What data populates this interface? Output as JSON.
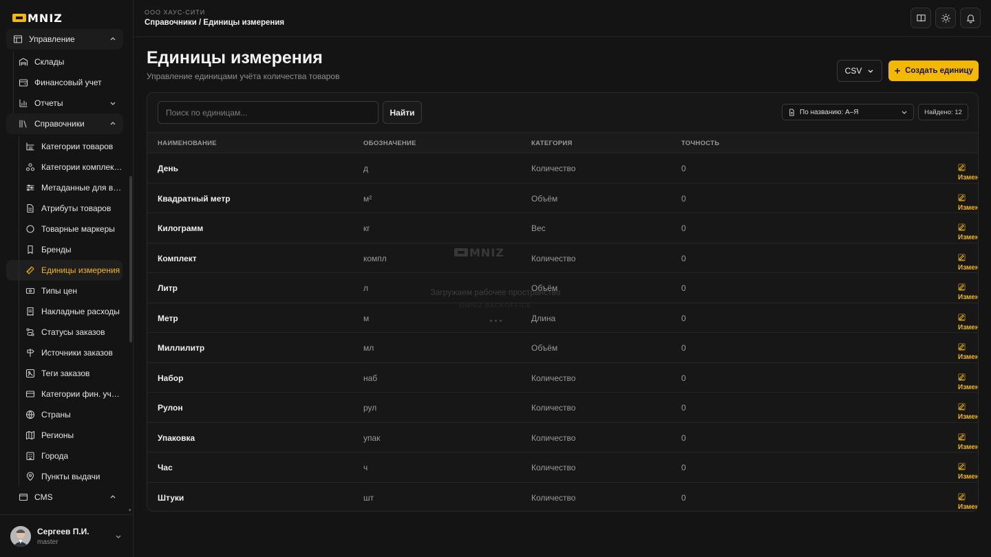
{
  "brand": {
    "logo_text": "OMNIZ",
    "accent": "#f5b800"
  },
  "sidebar": {
    "items": [
      {
        "label": "Управление",
        "icon": "layout-icon",
        "group": true,
        "chevron": "up"
      },
      {
        "label": "Склады",
        "icon": "warehouse-icon"
      },
      {
        "label": "Финансовый учет",
        "icon": "wallet-icon"
      },
      {
        "label": "Отчеты",
        "icon": "bar-chart-icon",
        "chevron": "down"
      },
      {
        "label": "Справочники",
        "icon": "library-icon",
        "group": true,
        "chevron": "up"
      },
      {
        "label": "Категории товаров",
        "icon": "category-list-icon"
      },
      {
        "label": "Категории комплектов",
        "icon": "components-icon"
      },
      {
        "label": "Метаданные для витрины",
        "icon": "sliders-icon"
      },
      {
        "label": "Атрибуты товаров",
        "icon": "file-text-icon"
      },
      {
        "label": "Товарные маркеры",
        "icon": "circle-icon"
      },
      {
        "label": "Бренды",
        "icon": "bookmark-icon"
      },
      {
        "label": "Единицы измерения",
        "icon": "ruler-icon",
        "active": true
      },
      {
        "label": "Типы цен",
        "icon": "banknote-icon"
      },
      {
        "label": "Накладные расходы",
        "icon": "receipt-icon"
      },
      {
        "label": "Статусы заказов",
        "icon": "route-icon"
      },
      {
        "label": "Источники заказов",
        "icon": "signpost-icon"
      },
      {
        "label": "Теги заказов",
        "icon": "tag-box-icon"
      },
      {
        "label": "Категории фин. учета",
        "icon": "credit-card-icon"
      },
      {
        "label": "Страны",
        "icon": "globe-icon"
      },
      {
        "label": "Регионы",
        "icon": "map-icon"
      },
      {
        "label": "Города",
        "icon": "building-icon"
      },
      {
        "label": "Пункты выдачи",
        "icon": "map-pin-icon"
      },
      {
        "label": "CMS",
        "icon": "window-icon",
        "chevron": "up"
      }
    ]
  },
  "user": {
    "name": "Сергеев П.И.",
    "role": "master"
  },
  "topbar": {
    "org": "ООО ХАУС-СИТИ",
    "breadcrumb": "Справочники / Единицы измерения"
  },
  "page": {
    "title": "Единицы измерения",
    "subtitle": "Управление единицами учёта количества товаров",
    "csv_label": "CSV",
    "create_label": "Создать единицу"
  },
  "toolbar": {
    "search_placeholder": "Поиск по единицам...",
    "find_label": "Найти",
    "sort_label": "По названию: А–Я",
    "found_label": "Найдено: 12"
  },
  "table": {
    "columns": [
      "НАИМЕНОВАНИЕ",
      "ОБОЗНАЧЕНИЕ",
      "КАТЕГОРИЯ",
      "ТОЧНОСТЬ"
    ],
    "edit_label": "Изменить",
    "rows": [
      {
        "name": "День",
        "symbol": "д",
        "category": "Количество",
        "precision": "0"
      },
      {
        "name": "Квадратный метр",
        "symbol": "м²",
        "category": "Объём",
        "precision": "0"
      },
      {
        "name": "Килограмм",
        "symbol": "кг",
        "category": "Вес",
        "precision": "0"
      },
      {
        "name": "Комплект",
        "symbol": "компл",
        "category": "Количество",
        "precision": "0"
      },
      {
        "name": "Литр",
        "symbol": "л",
        "category": "Объём",
        "precision": "0"
      },
      {
        "name": "Метр",
        "symbol": "м",
        "category": "Длина",
        "precision": "0"
      },
      {
        "name": "Миллилитр",
        "symbol": "мл",
        "category": "Объём",
        "precision": "0"
      },
      {
        "name": "Набор",
        "symbol": "наб",
        "category": "Количество",
        "precision": "0"
      },
      {
        "name": "Рулон",
        "symbol": "рул",
        "category": "Количество",
        "precision": "0"
      },
      {
        "name": "Упаковка",
        "symbol": "упак",
        "category": "Количество",
        "precision": "0"
      },
      {
        "name": "Час",
        "symbol": "ч",
        "category": "Количество",
        "precision": "0"
      },
      {
        "name": "Штуки",
        "symbol": "шт",
        "category": "Количество",
        "precision": "0"
      }
    ]
  },
  "overlay": {
    "title": "Загружаем рабочее пространство",
    "subtitle": "OMNIZ BACKOFFICE"
  }
}
